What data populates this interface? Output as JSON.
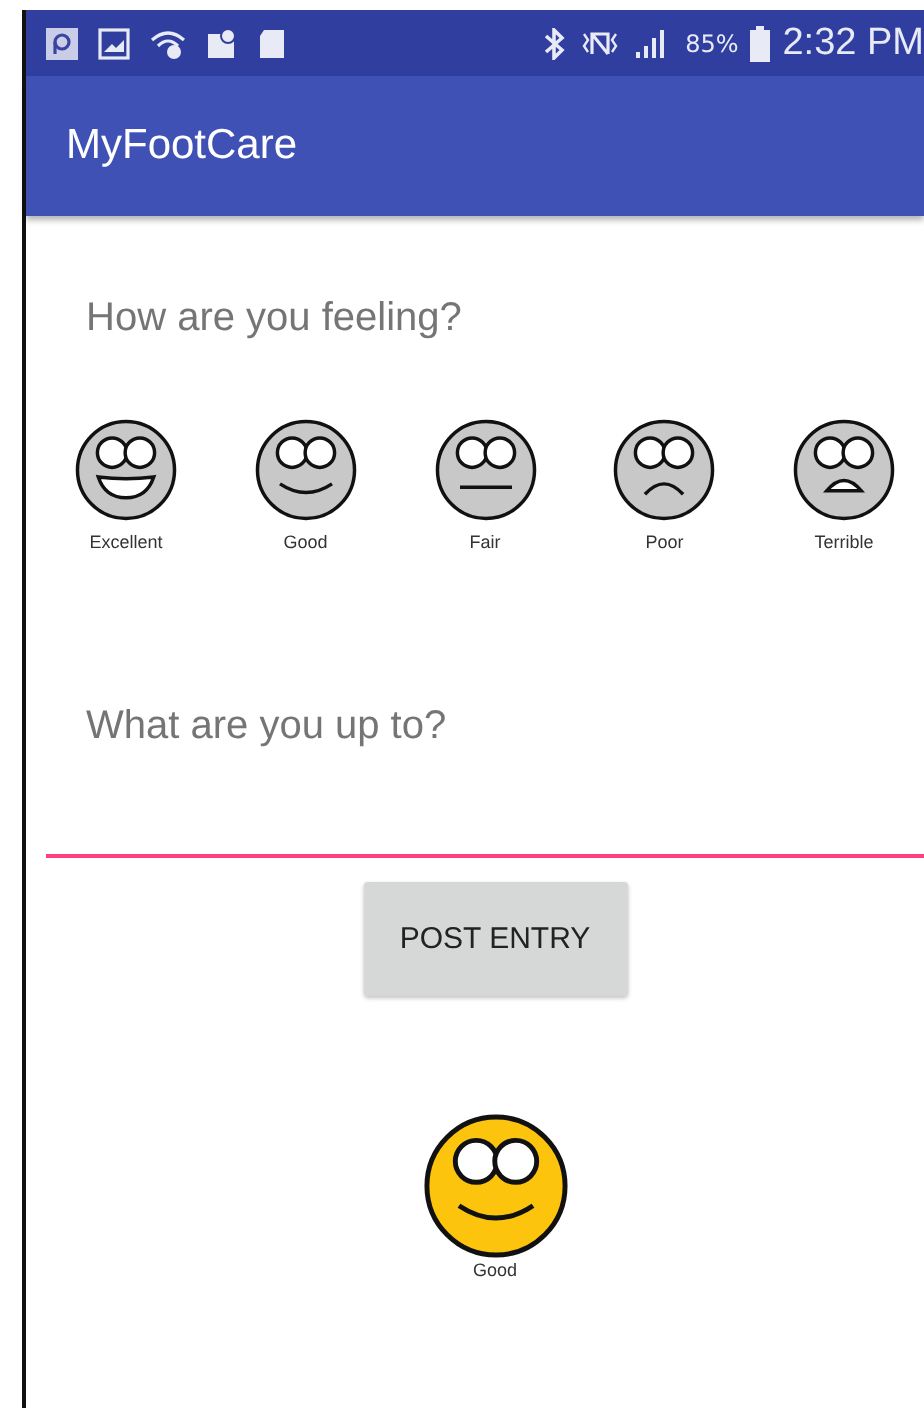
{
  "status_bar": {
    "battery": "85%",
    "time": "2:32 PM"
  },
  "app_bar": {
    "title": "MyFootCare"
  },
  "feeling": {
    "prompt": "How are you feeling?",
    "moods": [
      {
        "kind": "excellent",
        "label": "Excellent"
      },
      {
        "kind": "good",
        "label": "Good"
      },
      {
        "kind": "fair",
        "label": "Fair"
      },
      {
        "kind": "poor",
        "label": "Poor"
      },
      {
        "kind": "terrible",
        "label": "Terrible"
      }
    ]
  },
  "activity": {
    "placeholder": "What are you up to?"
  },
  "post_button": "POST ENTRY",
  "entry": {
    "kind": "good",
    "label": "Good"
  }
}
